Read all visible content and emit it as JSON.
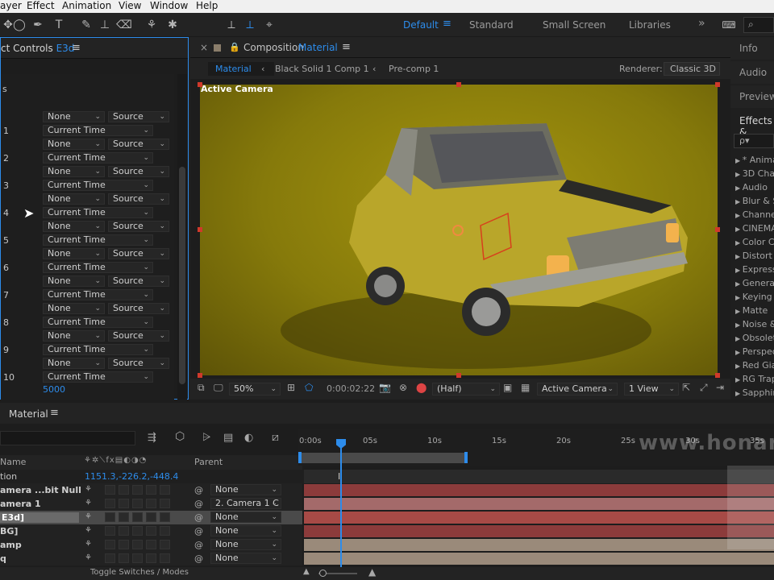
{
  "menu": [
    "ayer",
    "Effect",
    "Animation",
    "View",
    "Window",
    "Help"
  ],
  "toolbar": {
    "workspaces": [
      "Default",
      "Standard",
      "Small Screen",
      "Libraries"
    ],
    "active_workspace": "Default",
    "more": "»"
  },
  "effect_controls": {
    "title": "ct Controls",
    "layer": "E3d",
    "section_label": "s",
    "rows": [
      {
        "num": "",
        "a": "None",
        "b": "Source"
      },
      {
        "num": "1",
        "time": "Current Time"
      },
      {
        "num": "",
        "a": "None",
        "b": "Source"
      },
      {
        "num": "2",
        "time": "Current Time"
      },
      {
        "num": "",
        "a": "None",
        "b": "Source"
      },
      {
        "num": "3",
        "time": "Current Time"
      },
      {
        "num": "",
        "a": "None",
        "b": "Source"
      },
      {
        "num": "4",
        "time": "Current Time"
      },
      {
        "num": "",
        "a": "None",
        "b": "Source"
      },
      {
        "num": "5",
        "time": "Current Time"
      },
      {
        "num": "",
        "a": "None",
        "b": "Source"
      },
      {
        "num": "6",
        "time": "Current Time"
      },
      {
        "num": "",
        "a": "None",
        "b": "Source"
      },
      {
        "num": "7",
        "time": "Current Time"
      },
      {
        "num": "",
        "a": "None",
        "b": "Source"
      },
      {
        "num": "8",
        "time": "Current Time"
      },
      {
        "num": "",
        "a": "None",
        "b": "Source"
      },
      {
        "num": "9",
        "time": "Current Time"
      },
      {
        "num": "",
        "a": "None",
        "b": "Source"
      },
      {
        "num": "10",
        "time": "Current Time"
      }
    ],
    "bottom_value": "5000"
  },
  "composition": {
    "prefix": "Composition",
    "name": "Material",
    "breadcrumbs": [
      "Material",
      "Black Solid 1 Comp 1",
      "Pre-comp 1"
    ],
    "renderer_label": "Renderer:",
    "renderer": "Classic 3D",
    "camera_label": "Active Camera",
    "zoom": "50%",
    "timecode": "0:00:02:22",
    "resolution": "(Half)",
    "view_camera": "Active Camera",
    "views": "1 View"
  },
  "right_panel": {
    "titles": [
      "Info",
      "Audio",
      "Preview",
      "Effects &"
    ],
    "search_placeholder": "ρ▾",
    "effects": [
      "* Anima",
      "3D Chan",
      "Audio",
      "Blur & S",
      "Channel",
      "CINEMA",
      "Color Co",
      "Distort",
      "Express",
      "Generat",
      "Keying",
      "Matte",
      "Noise &",
      "Obsolet",
      "Perspec",
      "Red Gia",
      "RG Trap",
      "Sapphir"
    ]
  },
  "timeline": {
    "tab": "Material",
    "col_name": "Name",
    "col_parent": "Parent",
    "prop_name": "tion",
    "prop_value": "1151.3,-226.2,-448.4",
    "layers": [
      {
        "name": "amera ...bit Null",
        "parent": "None"
      },
      {
        "name": "amera 1",
        "parent": "2. Camera 1 C"
      },
      {
        "name": "E3d]",
        "parent": "None"
      },
      {
        "name": "BG]",
        "parent": "None"
      },
      {
        "name": "amp",
        "parent": "None"
      },
      {
        "name": "q",
        "parent": "None"
      }
    ],
    "ticks": [
      "0:00s",
      "05s",
      "10s",
      "15s",
      "20s",
      "25s",
      "30s",
      "35s"
    ],
    "toggle_label": "Toggle Switches / Modes",
    "watermark": "www.honar"
  },
  "colors": {
    "accent": "#2d8ceb",
    "comp_bg": "#8a7c0c",
    "layer_bar_red": "#8c3b3b",
    "layer_bar_pink": "#a46a6a"
  }
}
